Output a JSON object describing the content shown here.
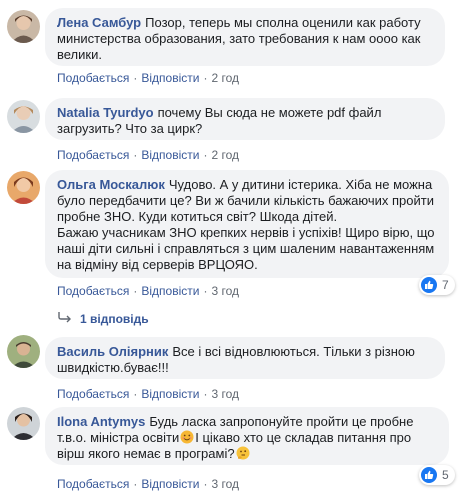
{
  "comments": [
    {
      "author": "Лена Самбур",
      "text": "Позор, теперь мы сполна оценили как работу министерства образования, зато требования к нам оооо как велики.",
      "like_label": "Подобається",
      "reply_label": "Відповісти",
      "time": "2 год"
    },
    {
      "author": "Natalia Tyurdyo",
      "text": "почему Вы сюда не можете pdf файл загрузить? Что за цирк?",
      "like_label": "Подобається",
      "reply_label": "Відповісти",
      "time": "2 год"
    },
    {
      "author": "Ольга Москалюк",
      "text_line1": "Чудово. А у дитини істерика. Хіба не можна було передбачити це? Ви ж бачили кількість бажаючих пройти пробне ЗНО. Куди котиться світ? Шкода дітей.",
      "text_line2": "Бажаю учасникам ЗНО крепких нервів і успіхів! Щиро вірю, що наші діти сильні і справляться з цим шаленим навантаженням на відміну від серверів ВРЦОЯО.",
      "like_label": "Подобається",
      "reply_label": "Відповісти",
      "time": "3 год",
      "reaction_count": "7",
      "replies_label": "1 відповідь"
    },
    {
      "author": "Василь Оліярник",
      "text": "Все і всі відновлюються. Тільки з різною швидкістю.буває!!!",
      "like_label": "Подобається",
      "reply_label": "Відповісти",
      "time": "3 год"
    },
    {
      "author": "Ilona Antymys",
      "text_a": "Будь ласка запропонуйте пройти це пробне т.в.о. міністра освіти",
      "text_b": "І цікаво хто це складав питання про вірш якого немає в програмі?",
      "like_label": "Подобається",
      "reply_label": "Відповісти",
      "time": "3 год",
      "reaction_count": "5"
    }
  ],
  "colors": {
    "author": "#385898",
    "bubble": "#f2f3f5",
    "meta": "#606770",
    "like_blue": "#1877f2"
  },
  "icons": [
    "avatar",
    "like-icon",
    "reply-arrow-icon",
    "smile-emoji-icon",
    "thinking-emoji-icon"
  ]
}
